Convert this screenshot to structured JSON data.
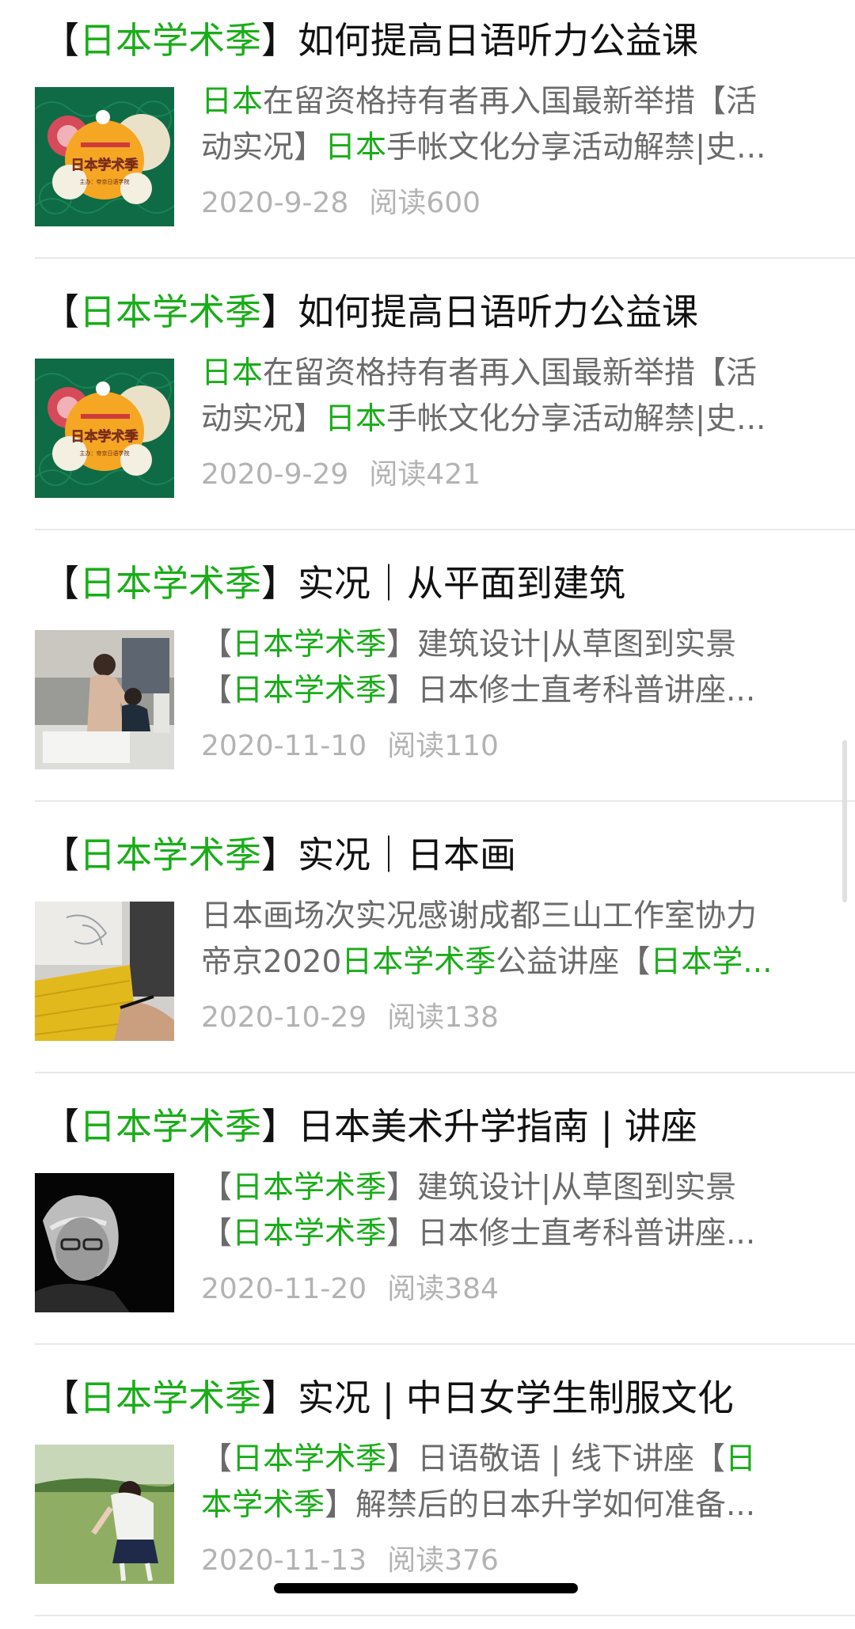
{
  "articles": [
    {
      "title": {
        "l": "【",
        "h": "日本学术季",
        "r": "】如何提高日语听力公益课"
      },
      "line1": [
        {
          "t": "日本",
          "hl": true
        },
        {
          "t": "在留资格持有者再入国最新举措【活",
          "hl": false
        }
      ],
      "line2": [
        {
          "t": "动实况】",
          "hl": false
        },
        {
          "t": "日本",
          "hl": true
        },
        {
          "t": "手帐文化分享活动解禁|史...",
          "hl": false
        }
      ],
      "date": "2020-9-28",
      "reads": "阅读600",
      "thumb": "poster-green-icon",
      "thumb_text": "日本学术季",
      "thumb_sub": "主办：帝京日语学院"
    },
    {
      "title": {
        "l": "【",
        "h": "日本学术季",
        "r": "】如何提高日语听力公益课"
      },
      "line1": [
        {
          "t": "日本",
          "hl": true
        },
        {
          "t": "在留资格持有者再入国最新举措【活",
          "hl": false
        }
      ],
      "line2": [
        {
          "t": "动实况】",
          "hl": false
        },
        {
          "t": "日本",
          "hl": true
        },
        {
          "t": "手帐文化分享活动解禁|史...",
          "hl": false
        }
      ],
      "date": "2020-9-29",
      "reads": "阅读421",
      "thumb": "poster-green-icon",
      "thumb_text": "日本学术季",
      "thumb_sub": "主办：帝京日语学院"
    },
    {
      "title": {
        "l": "【",
        "h": "日本学术季",
        "r": "】实况｜从平面到建筑"
      },
      "line1": [
        {
          "t": "【",
          "hl": false
        },
        {
          "t": "日本学术季",
          "hl": true
        },
        {
          "t": "】建筑设计|从草图到实景",
          "hl": false
        }
      ],
      "line2": [
        {
          "t": "【",
          "hl": false
        },
        {
          "t": "日本学术季",
          "hl": true
        },
        {
          "t": "】日本修士直考科普讲座...",
          "hl": false
        }
      ],
      "date": "2020-11-10",
      "reads": "阅读110",
      "thumb": "classroom-photo"
    },
    {
      "title": {
        "l": "【",
        "h": "日本学术季",
        "r": "】实况｜日本画"
      },
      "line1": [
        {
          "t": "日本画场次实况感谢成都三山工作室协力",
          "hl": false
        }
      ],
      "line2": [
        {
          "t": "帝京2020",
          "hl": false
        },
        {
          "t": "日本学术季",
          "hl": true
        },
        {
          "t": "公益讲座【",
          "hl": false
        },
        {
          "t": "日本学...",
          "hl": true
        }
      ],
      "date": "2020-10-29",
      "reads": "阅读138",
      "thumb": "drawing-photo"
    },
    {
      "title": {
        "l": "【",
        "h": "日本学术季",
        "r": "】日本美术升学指南 | 讲座"
      },
      "line1": [
        {
          "t": "【",
          "hl": false
        },
        {
          "t": "日本学术季",
          "hl": true
        },
        {
          "t": "】建筑设计|从草图到实景",
          "hl": false
        }
      ],
      "line2": [
        {
          "t": "【",
          "hl": false
        },
        {
          "t": "日本学术季",
          "hl": true
        },
        {
          "t": "】日本修士直考科普讲座...",
          "hl": false
        }
      ],
      "date": "2020-11-20",
      "reads": "阅读384",
      "thumb": "portrait-photo"
    },
    {
      "title": {
        "l": "【",
        "h": "日本学术季",
        "r": "】实况 | 中日女学生制服文化"
      },
      "line1": [
        {
          "t": "【",
          "hl": false
        },
        {
          "t": "日本学术季",
          "hl": true
        },
        {
          "t": "】日语敬语 | 线下讲座【",
          "hl": false
        },
        {
          "t": "日",
          "hl": true
        }
      ],
      "line2": [
        {
          "t": "本学术季",
          "hl": true
        },
        {
          "t": "】解禁后的日本升学如何准备...",
          "hl": false
        }
      ],
      "date": "2020-11-13",
      "reads": "阅读376",
      "thumb": "uniform-photo"
    }
  ],
  "colors": {
    "highlight": "#1aad19",
    "title": "#111111",
    "summary": "#6b6b6b",
    "meta": "#b3b3b3"
  }
}
